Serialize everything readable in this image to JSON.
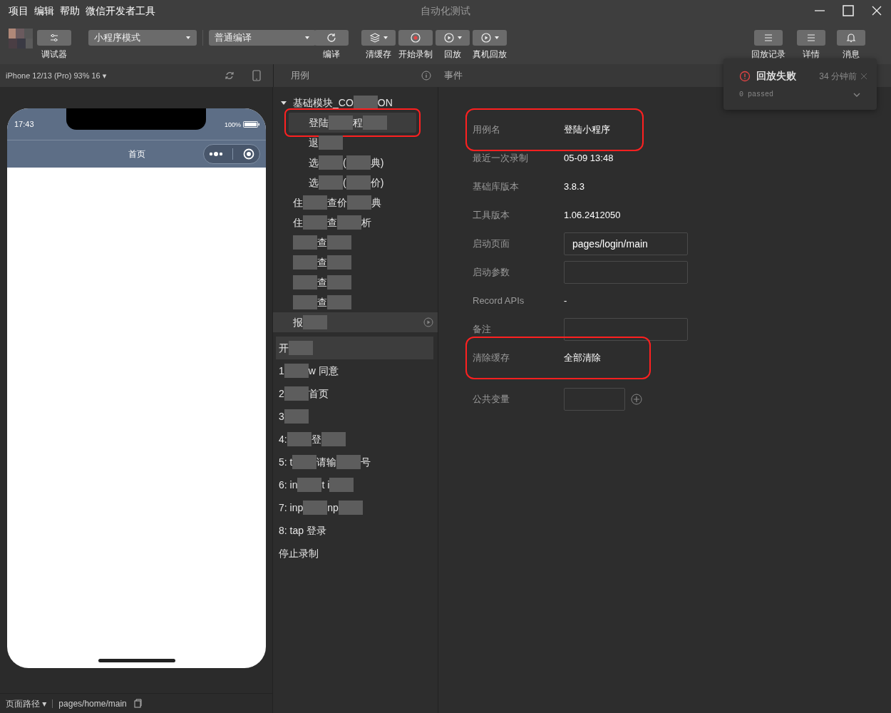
{
  "menu": [
    "项目",
    "编辑",
    "帮助",
    "微信开发者工具"
  ],
  "window": {
    "title": "自动化测试"
  },
  "toolbar": {
    "left": [
      {
        "kind": "icon",
        "label": "调试器"
      },
      {
        "kind": "select",
        "value": "小程序模式"
      },
      {
        "kind": "select",
        "value": "普通编译"
      },
      {
        "kind": "icon",
        "label": "编译"
      },
      {
        "kind": "icon",
        "caret": true,
        "label": "清缓存"
      },
      {
        "kind": "icon",
        "label": "开始录制"
      },
      {
        "kind": "icon",
        "caret": true,
        "label": "回放"
      },
      {
        "kind": "icon",
        "caret": true,
        "label": "真机回放"
      }
    ],
    "right": [
      {
        "label": "回放记录"
      },
      {
        "label": "详情"
      },
      {
        "label": "消息"
      }
    ]
  },
  "simulator": {
    "device": "iPhone 12/13 (Pro) 93% 16 ▾",
    "time": "17:43",
    "battery": "100%",
    "page_title": "首页"
  },
  "cases_header": "用例",
  "events_header": "事件",
  "tree": [
    {
      "segments": [
        {
          "kind": "text",
          "text": "基础模块_CO"
        },
        {
          "kind": "blur"
        },
        {
          "kind": "text",
          "text": "ON"
        }
      ],
      "expanded": true,
      "children": [
        {
          "segments": [
            {
              "kind": "text",
              "text": "登陆"
            },
            {
              "kind": "blur"
            },
            {
              "kind": "text",
              "text": "程"
            },
            {
              "kind": "blur"
            }
          ],
          "selected": true,
          "annotated": true
        },
        {
          "segments": [
            {
              "kind": "text",
              "text": "退"
            },
            {
              "kind": "blur"
            }
          ],
          "selected": false,
          "annotated": false
        },
        {
          "segments": [
            {
              "kind": "text",
              "text": "选"
            },
            {
              "kind": "blur"
            },
            {
              "kind": "text",
              "text": "("
            },
            {
              "kind": "blur"
            },
            {
              "kind": "text",
              "text": "典)"
            }
          ],
          "selected": false,
          "annotated": false
        },
        {
          "segments": [
            {
              "kind": "text",
              "text": "选"
            },
            {
              "kind": "blur"
            },
            {
              "kind": "text",
              "text": "("
            },
            {
              "kind": "blur"
            },
            {
              "kind": "text",
              "text": "价)"
            }
          ],
          "selected": false,
          "annotated": false
        }
      ]
    },
    {
      "segments": [
        {
          "kind": "text",
          "text": "住"
        },
        {
          "kind": "blur"
        },
        {
          "kind": "text",
          "text": "查价"
        },
        {
          "kind": "blur"
        },
        {
          "kind": "text",
          "text": "典"
        }
      ]
    },
    {
      "segments": [
        {
          "kind": "text",
          "text": "住"
        },
        {
          "kind": "blur"
        },
        {
          "kind": "text",
          "text": "查"
        },
        {
          "kind": "blur"
        },
        {
          "kind": "text",
          "text": "析"
        }
      ]
    },
    {
      "segments": [
        {
          "kind": "blur"
        },
        {
          "kind": "text",
          "text": "查"
        },
        {
          "kind": "blur"
        }
      ]
    },
    {
      "segments": [
        {
          "kind": "blur"
        },
        {
          "kind": "text",
          "text": "查"
        },
        {
          "kind": "blur"
        }
      ]
    },
    {
      "segments": [
        {
          "kind": "blur"
        },
        {
          "kind": "text",
          "text": "查"
        },
        {
          "kind": "blur"
        }
      ]
    },
    {
      "segments": [
        {
          "kind": "blur"
        },
        {
          "kind": "text",
          "text": "查"
        },
        {
          "kind": "blur"
        }
      ]
    },
    {
      "segments": [
        {
          "kind": "text",
          "text": "报"
        },
        {
          "kind": "blur"
        }
      ],
      "playable": true
    }
  ],
  "events": [
    {
      "segments": [
        {
          "kind": "text",
          "text": "开"
        },
        {
          "kind": "blur"
        }
      ],
      "header": true
    },
    {
      "segments": [
        {
          "kind": "text",
          "text": "1"
        },
        {
          "kind": "blur"
        },
        {
          "kind": "text",
          "text": "w 同意"
        }
      ]
    },
    {
      "segments": [
        {
          "kind": "text",
          "text": "2"
        },
        {
          "kind": "blur"
        },
        {
          "kind": "text",
          "text": "首页"
        }
      ]
    },
    {
      "segments": [
        {
          "kind": "text",
          "text": "3"
        },
        {
          "kind": "blur"
        }
      ]
    },
    {
      "segments": [
        {
          "kind": "text",
          "text": "4:"
        },
        {
          "kind": "blur"
        },
        {
          "kind": "text",
          "text": "登"
        },
        {
          "kind": "blur"
        }
      ]
    },
    {
      "segments": [
        {
          "kind": "text",
          "text": "5: t"
        },
        {
          "kind": "blur"
        },
        {
          "kind": "text",
          "text": "请输"
        },
        {
          "kind": "blur"
        },
        {
          "kind": "text",
          "text": "号"
        }
      ]
    },
    {
      "segments": [
        {
          "kind": "text",
          "text": "6: in"
        },
        {
          "kind": "blur"
        },
        {
          "kind": "text",
          "text": "t i"
        },
        {
          "kind": "blur"
        }
      ]
    },
    {
      "segments": [
        {
          "kind": "text",
          "text": "7: inp"
        },
        {
          "kind": "blur"
        },
        {
          "kind": "text",
          "text": "np"
        },
        {
          "kind": "blur"
        }
      ]
    },
    {
      "segments": [
        {
          "kind": "text",
          "text": "8: tap 登录"
        }
      ]
    },
    {
      "segments": [
        {
          "kind": "text",
          "text": "停止录制"
        }
      ]
    }
  ],
  "details": [
    {
      "kind": "text",
      "label": "用例名",
      "value": "登陆小程序",
      "annotated": true
    },
    {
      "kind": "text",
      "label": "最近一次录制",
      "value": "05-09 13:48"
    },
    {
      "kind": "text",
      "label": "基础库版本",
      "value": "3.8.3"
    },
    {
      "kind": "text",
      "label": "工具版本",
      "value": "1.06.2412050"
    },
    {
      "kind": "input",
      "label": "启动页面",
      "value": "pages/login/main"
    },
    {
      "kind": "input",
      "label": "启动参数"
    },
    {
      "kind": "text",
      "label": "Record APIs",
      "value": "-"
    },
    {
      "kind": "input",
      "label": "备注"
    },
    {
      "kind": "text",
      "label": "清除缓存",
      "value": "全部清除",
      "annotated": true
    },
    {
      "kind": "add",
      "label": "公共变量"
    }
  ],
  "notification": {
    "title": "回放失败",
    "time": "34 分钟前",
    "detail": "0 passed"
  },
  "footer": {
    "label": "页面路径 ▾",
    "path": "pages/home/main"
  }
}
